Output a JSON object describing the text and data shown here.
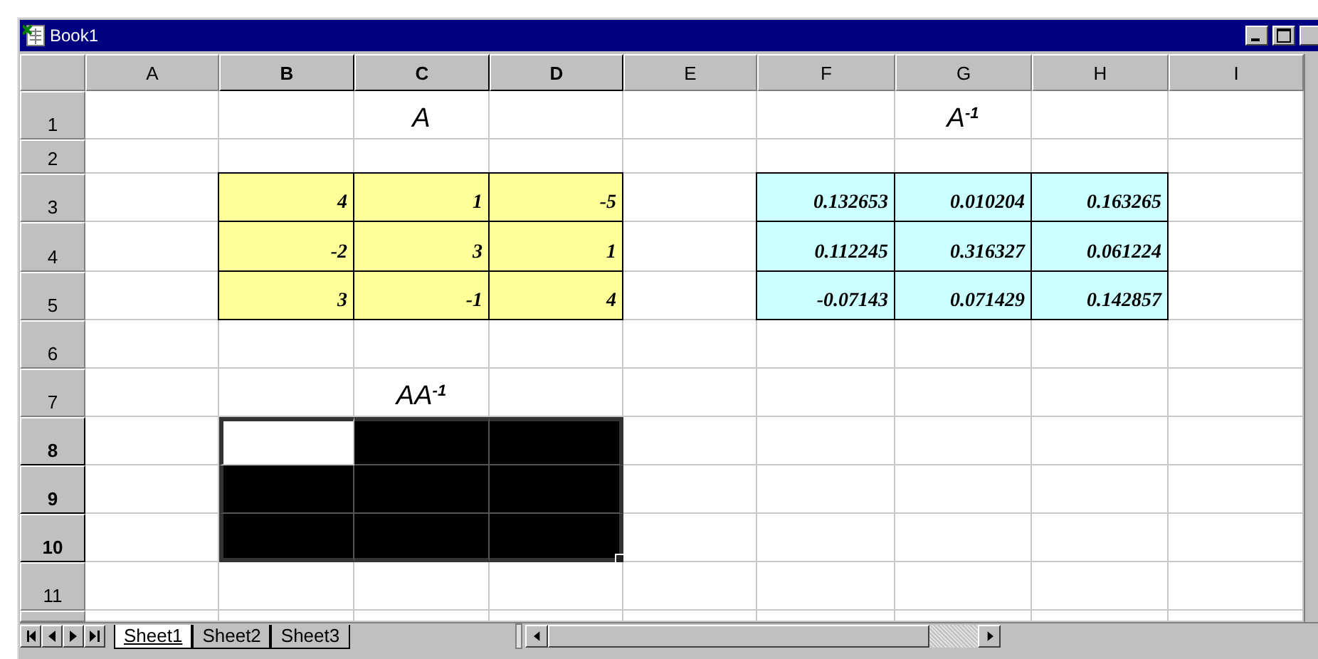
{
  "window": {
    "title": "Book1"
  },
  "columns": [
    {
      "label": "A",
      "selected": false
    },
    {
      "label": "B",
      "selected": true
    },
    {
      "label": "C",
      "selected": true
    },
    {
      "label": "D",
      "selected": true
    },
    {
      "label": "E",
      "selected": false
    },
    {
      "label": "F",
      "selected": false
    },
    {
      "label": "G",
      "selected": false
    },
    {
      "label": "H",
      "selected": false
    },
    {
      "label": "I",
      "selected": false
    }
  ],
  "rows": [
    {
      "label": "1",
      "selected": false,
      "cells": [
        {
          "selected": false
        },
        {
          "selected": false
        },
        {
          "text": "A",
          "kind": "heading",
          "selected": false
        },
        {
          "selected": false
        },
        {
          "selected": false
        },
        {
          "selected": false
        },
        {
          "text": "A$^{-1}$",
          "kind": "heading",
          "selected": false
        },
        {
          "selected": false
        },
        {
          "selected": false
        }
      ]
    },
    {
      "label": "2",
      "selected": false,
      "cells": [
        {
          "selected": false
        },
        {
          "selected": false
        },
        {
          "selected": false
        },
        {
          "selected": false
        },
        {
          "selected": false
        },
        {
          "selected": false
        },
        {
          "selected": false
        },
        {
          "selected": false
        },
        {
          "selected": false
        }
      ]
    },
    {
      "label": "3",
      "selected": false,
      "cells": [
        {
          "selected": false
        },
        {
          "text": "4",
          "kind": "number",
          "color": "#ffff99",
          "selected": false
        },
        {
          "text": "1",
          "kind": "number",
          "color": "#ffff99",
          "selected": false
        },
        {
          "text": "-5",
          "kind": "number",
          "color": "#ffff99",
          "selected": false
        },
        {
          "selected": false
        },
        {
          "text": "0.132653",
          "kind": "number",
          "color": "#ccffff",
          "selected": false
        },
        {
          "text": "0.010204",
          "kind": "number",
          "color": "#ccffff",
          "selected": false
        },
        {
          "text": "0.163265",
          "kind": "number",
          "color": "#ccffff",
          "selected": false
        },
        {
          "selected": false
        }
      ]
    },
    {
      "label": "4",
      "selected": false,
      "cells": [
        {
          "selected": false
        },
        {
          "text": "-2",
          "kind": "number",
          "color": "#ffff99",
          "selected": false
        },
        {
          "text": "3",
          "kind": "number",
          "color": "#ffff99",
          "selected": false
        },
        {
          "text": "1",
          "kind": "number",
          "color": "#ffff99",
          "selected": false
        },
        {
          "selected": false
        },
        {
          "text": "0.112245",
          "kind": "number",
          "color": "#ccffff",
          "selected": false
        },
        {
          "text": "0.316327",
          "kind": "number",
          "color": "#ccffff",
          "selected": false
        },
        {
          "text": "0.061224",
          "kind": "number",
          "color": "#ccffff",
          "selected": false
        },
        {
          "selected": false
        }
      ]
    },
    {
      "label": "5",
      "selected": false,
      "cells": [
        {
          "selected": false
        },
        {
          "text": "3",
          "kind": "number",
          "color": "#ffff99",
          "selected": false
        },
        {
          "text": "-1",
          "kind": "number",
          "color": "#ffff99",
          "selected": false
        },
        {
          "text": "4",
          "kind": "number",
          "color": "#ffff99",
          "selected": false
        },
        {
          "selected": false
        },
        {
          "text": "-0.07143",
          "kind": "number",
          "color": "#ccffff",
          "selected": false
        },
        {
          "text": "0.071429",
          "kind": "number",
          "color": "#ccffff",
          "selected": false
        },
        {
          "text": "0.142857",
          "kind": "number",
          "color": "#ccffff",
          "selected": false
        },
        {
          "selected": false
        }
      ]
    },
    {
      "label": "6",
      "selected": false,
      "cells": [
        {
          "selected": false
        },
        {
          "selected": false
        },
        {
          "selected": false
        },
        {
          "selected": false
        },
        {
          "selected": false
        },
        {
          "selected": false
        },
        {
          "selected": false
        },
        {
          "selected": false
        },
        {
          "selected": false
        }
      ]
    },
    {
      "label": "7",
      "selected": false,
      "cells": [
        {
          "selected": false
        },
        {
          "selected": false
        },
        {
          "text": "AA$^{-1}$",
          "kind": "heading",
          "selected": false
        },
        {
          "selected": false
        },
        {
          "selected": false
        },
        {
          "selected": false
        },
        {
          "selected": false
        },
        {
          "selected": false
        },
        {
          "selected": false
        }
      ]
    },
    {
      "label": "8",
      "selected": true,
      "cells": [
        {
          "selected": false
        },
        {
          "selected": true,
          "active": true
        },
        {
          "selected": true,
          "active": false
        },
        {
          "selected": true,
          "active": false
        },
        {
          "selected": false
        },
        {
          "selected": false
        },
        {
          "selected": false
        },
        {
          "selected": false
        },
        {
          "selected": false
        }
      ]
    },
    {
      "label": "9",
      "selected": true,
      "cells": [
        {
          "selected": false
        },
        {
          "selected": true,
          "active": false
        },
        {
          "selected": true,
          "active": false
        },
        {
          "selected": true,
          "active": false
        },
        {
          "selected": false
        },
        {
          "selected": false
        },
        {
          "selected": false
        },
        {
          "selected": false
        },
        {
          "selected": false
        }
      ]
    },
    {
      "label": "10",
      "selected": true,
      "cells": [
        {
          "selected": false
        },
        {
          "selected": true,
          "active": false
        },
        {
          "selected": true,
          "active": false
        },
        {
          "selected": true,
          "active": false
        },
        {
          "selected": false
        },
        {
          "selected": false
        },
        {
          "selected": false
        },
        {
          "selected": false
        },
        {
          "selected": false
        }
      ]
    },
    {
      "label": "11",
      "selected": false,
      "cells": [
        {
          "selected": false
        },
        {
          "selected": false
        },
        {
          "selected": false
        },
        {
          "selected": false
        },
        {
          "selected": false
        },
        {
          "selected": false
        },
        {
          "selected": false
        },
        {
          "selected": false
        },
        {
          "selected": false
        }
      ]
    }
  ],
  "sheet_tabs": [
    {
      "label": "Sheet1",
      "selected": true
    },
    {
      "label": "Sheet2",
      "selected": false
    },
    {
      "label": "Sheet3",
      "selected": false
    }
  ]
}
